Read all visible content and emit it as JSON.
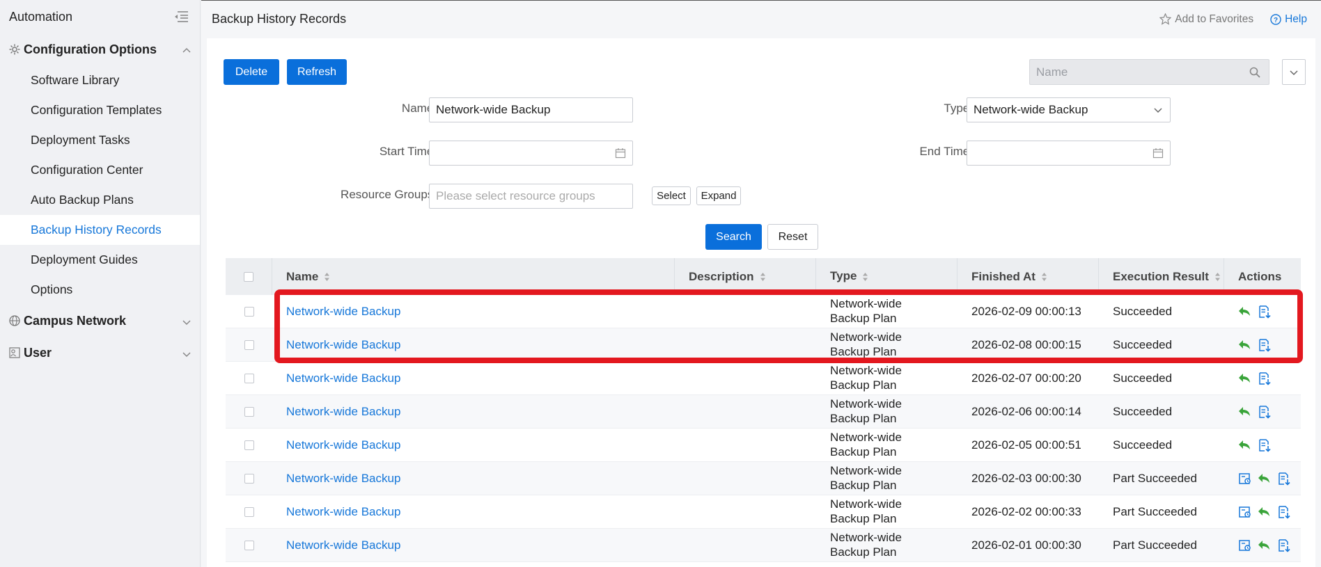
{
  "sidebar": {
    "title": "Automation",
    "groups": [
      {
        "label": "Configuration Options",
        "expanded": true,
        "icon": "gear-icon"
      },
      {
        "label": "Campus Network",
        "expanded": false,
        "icon": "globe-icon"
      },
      {
        "label": "User",
        "expanded": false,
        "icon": "users-icon"
      }
    ],
    "items": [
      {
        "label": "Software Library"
      },
      {
        "label": "Configuration Templates"
      },
      {
        "label": "Deployment Tasks"
      },
      {
        "label": "Configuration Center"
      },
      {
        "label": "Auto Backup Plans"
      },
      {
        "label": "Backup History Records",
        "active": true
      },
      {
        "label": "Deployment Guides"
      },
      {
        "label": "Options"
      }
    ]
  },
  "header": {
    "title": "Backup History Records",
    "favorites_label": "Add to Favorites",
    "help_label": "Help"
  },
  "toolbar": {
    "delete_label": "Delete",
    "refresh_label": "Refresh",
    "name_search_placeholder": "Name"
  },
  "filters": {
    "name_label": "Name:",
    "name_value": "Network-wide Backup",
    "type_label": "Type:",
    "type_value": "Network-wide Backup",
    "start_label": "Start Time:",
    "end_label": "End Time:",
    "resource_label": "Resource Groups:",
    "resource_placeholder": "Please select resource groups",
    "select_label": "Select",
    "expand_label": "Expand",
    "search_label": "Search",
    "reset_label": "Reset"
  },
  "table": {
    "columns": [
      "Name",
      "Description",
      "Type",
      "Finished At",
      "Execution Result",
      "Actions"
    ],
    "rows": [
      {
        "name": "Network-wide Backup",
        "description": "",
        "type": "Network-wide Backup Plan",
        "finished": "2026-02-09 00:00:13",
        "result": "Succeeded",
        "actions": [
          "restore-icon",
          "download-icon"
        ]
      },
      {
        "name": "Network-wide Backup",
        "description": "",
        "type": "Network-wide Backup Plan",
        "finished": "2026-02-08 00:00:15",
        "result": "Succeeded",
        "actions": [
          "restore-icon",
          "download-icon"
        ]
      },
      {
        "name": "Network-wide Backup",
        "description": "",
        "type": "Network-wide Backup Plan",
        "finished": "2026-02-07 00:00:20",
        "result": "Succeeded",
        "actions": [
          "restore-icon",
          "download-icon"
        ]
      },
      {
        "name": "Network-wide Backup",
        "description": "",
        "type": "Network-wide Backup Plan",
        "finished": "2026-02-06 00:00:14",
        "result": "Succeeded",
        "actions": [
          "restore-icon",
          "download-icon"
        ]
      },
      {
        "name": "Network-wide Backup",
        "description": "",
        "type": "Network-wide Backup Plan",
        "finished": "2026-02-05 00:00:51",
        "result": "Succeeded",
        "actions": [
          "restore-icon",
          "download-icon"
        ]
      },
      {
        "name": "Network-wide Backup",
        "description": "",
        "type": "Network-wide Backup Plan",
        "finished": "2026-02-03 00:00:30",
        "result": "Part Succeeded",
        "actions": [
          "details-icon",
          "restore-icon",
          "download-icon"
        ]
      },
      {
        "name": "Network-wide Backup",
        "description": "",
        "type": "Network-wide Backup Plan",
        "finished": "2026-02-02 00:00:33",
        "result": "Part Succeeded",
        "actions": [
          "details-icon",
          "restore-icon",
          "download-icon"
        ]
      },
      {
        "name": "Network-wide Backup",
        "description": "",
        "type": "Network-wide Backup Plan",
        "finished": "2026-02-01 00:00:30",
        "result": "Part Succeeded",
        "actions": [
          "details-icon",
          "restore-icon",
          "download-icon"
        ]
      }
    ]
  },
  "colors": {
    "primary": "#0a6fdb",
    "link": "#1677d9",
    "highlight": "#e3181f",
    "restore_icon": "#3aa43a"
  }
}
